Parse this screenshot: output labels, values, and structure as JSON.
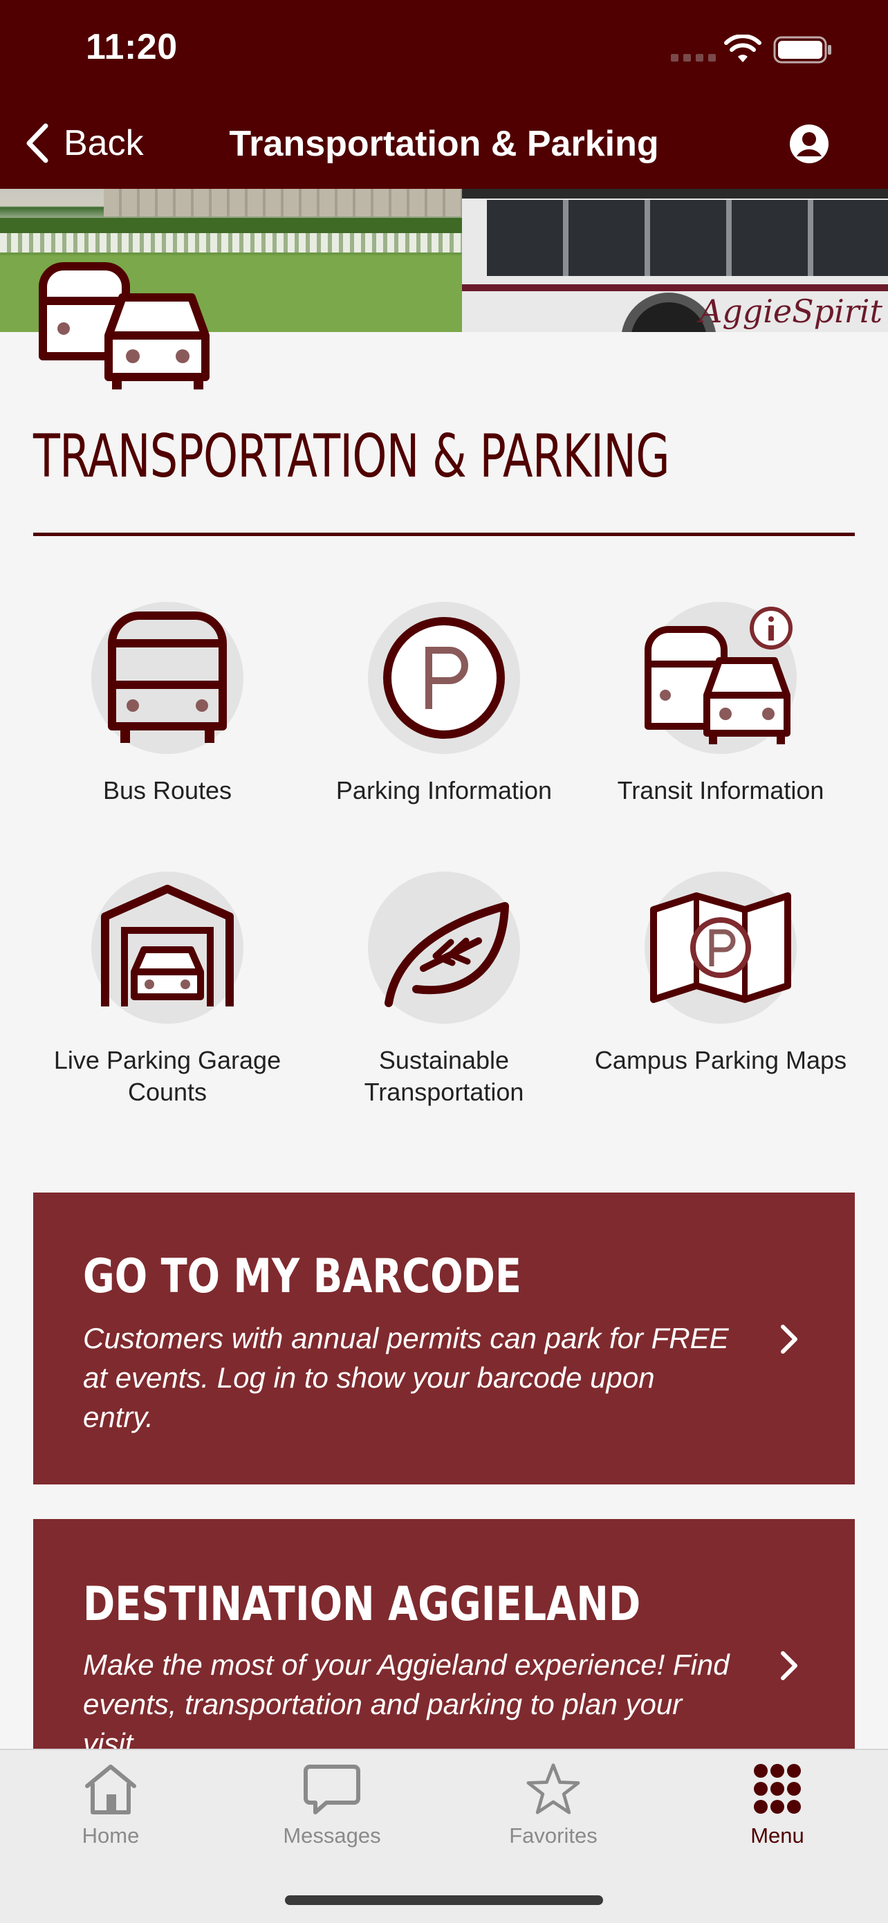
{
  "status_bar": {
    "time": "11:20"
  },
  "nav": {
    "back_label": "Back",
    "title": "Transportation & Parking"
  },
  "hero": {
    "bus_brand": "AggieSpirit"
  },
  "section": {
    "title": "TRANSPORTATION & PARKING"
  },
  "tiles": [
    {
      "label": "Bus Routes",
      "icon": "bus-icon"
    },
    {
      "label": "Parking Information",
      "icon": "parking-icon"
    },
    {
      "label": "Transit Information",
      "icon": "transit-info-icon"
    },
    {
      "label": "Live Parking Garage Counts",
      "icon": "garage-icon"
    },
    {
      "label": "Sustainable Transportation",
      "icon": "leaf-icon"
    },
    {
      "label": "Campus Parking Maps",
      "icon": "parking-map-icon"
    }
  ],
  "cards": [
    {
      "title": "GO TO MY BARCODE",
      "description": "Customers with annual permits can park for FREE at events. Log in to show your barcode upon entry."
    },
    {
      "title": "DESTINATION AGGIELAND",
      "description": "Make the most of your Aggieland experience! Find events, transportation and parking to plan your visit."
    }
  ],
  "tabbar": {
    "items": [
      {
        "label": "Home",
        "icon": "home-icon"
      },
      {
        "label": "Messages",
        "icon": "messages-icon"
      },
      {
        "label": "Favorites",
        "icon": "star-icon"
      },
      {
        "label": "Menu",
        "icon": "menu-grid-icon",
        "active": true
      }
    ]
  },
  "colors": {
    "maroon": "#500000",
    "card": "#7f2a2e",
    "background": "#f5f5f5"
  }
}
